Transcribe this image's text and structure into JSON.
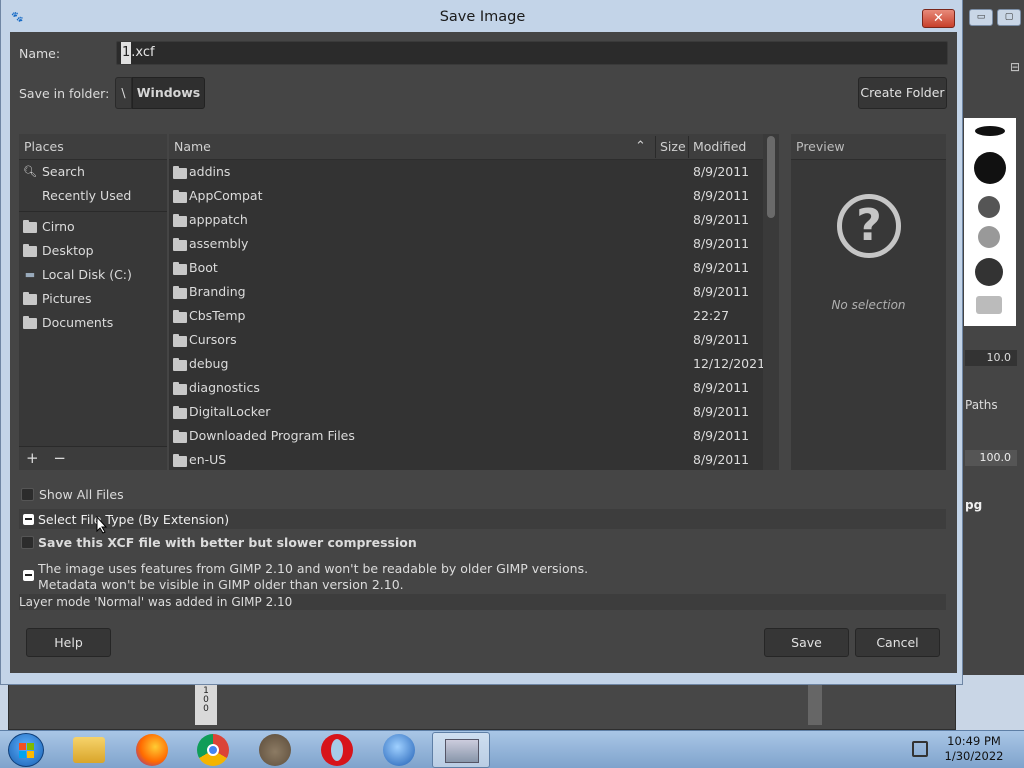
{
  "dialog": {
    "title": "Save Image",
    "close_label": "✕"
  },
  "name_row": {
    "label": "Name:",
    "caret_char": "1",
    "rest": ".xcf"
  },
  "folder_row": {
    "label": "Save in folder:",
    "path_root": "\\",
    "path_current": "Windows",
    "create_folder": "Create Folder"
  },
  "places": {
    "header": "Places",
    "items": [
      {
        "label": "Search",
        "icon": "search-icon"
      },
      {
        "label": "Recently Used",
        "icon": "recent-icon"
      },
      {
        "label": "Cirno",
        "icon": "folder-icon"
      },
      {
        "label": "Desktop",
        "icon": "folder-icon"
      },
      {
        "label": "Local Disk (C:)",
        "icon": "drive-icon"
      },
      {
        "label": "Pictures",
        "icon": "folder-icon"
      },
      {
        "label": "Documents",
        "icon": "folder-icon"
      }
    ],
    "add": "+",
    "remove": "−"
  },
  "files": {
    "columns": {
      "name": "Name",
      "size": "Size",
      "modified": "Modified"
    },
    "rows": [
      {
        "name": "addins",
        "modified": "8/9/2011"
      },
      {
        "name": "AppCompat",
        "modified": "8/9/2011"
      },
      {
        "name": "apppatch",
        "modified": "8/9/2011"
      },
      {
        "name": "assembly",
        "modified": "8/9/2011"
      },
      {
        "name": "Boot",
        "modified": "8/9/2011"
      },
      {
        "name": "Branding",
        "modified": "8/9/2011"
      },
      {
        "name": "CbsTemp",
        "modified": "22:27"
      },
      {
        "name": "Cursors",
        "modified": "8/9/2011"
      },
      {
        "name": "debug",
        "modified": "12/12/2021"
      },
      {
        "name": "diagnostics",
        "modified": "8/9/2011"
      },
      {
        "name": "DigitalLocker",
        "modified": "8/9/2011"
      },
      {
        "name": "Downloaded Program Files",
        "modified": "8/9/2011"
      },
      {
        "name": "en-US",
        "modified": "8/9/2011"
      }
    ]
  },
  "preview": {
    "header": "Preview",
    "icon": "?",
    "empty": "No selection"
  },
  "options": {
    "show_all_files": "Show All Files",
    "select_file_type": "Select File Type (By Extension)",
    "compression": "Save this XCF file with better but slower compression",
    "compat_line1": "The image uses features from GIMP 2.10 and won't be readable by older GIMP versions.",
    "compat_line2": "Metadata won't be visible in GIMP older than version 2.10.",
    "layer_mode": "Layer mode 'Normal' was added in GIMP 2.10"
  },
  "buttons": {
    "help": "Help",
    "save": "Save",
    "cancel": "Cancel"
  },
  "background_app": {
    "spin_value": "10.0",
    "tab_label": "Paths",
    "opacity_value": "100.0",
    "layer_name": "pg",
    "ruler_digits": "1\n0\n0"
  },
  "taskbar": {
    "time": "10:49 PM",
    "date": "1/30/2022"
  }
}
